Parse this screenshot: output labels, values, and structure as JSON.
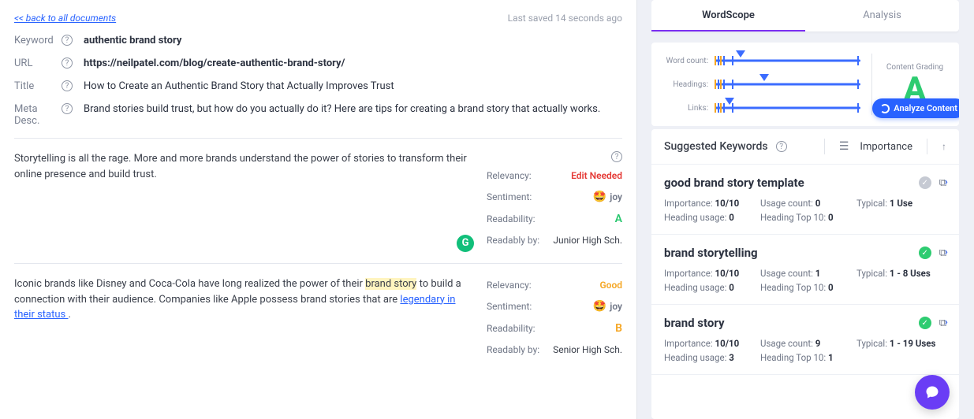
{
  "header": {
    "back_label": "<< back to all documents",
    "saved_label": "Last saved 14 seconds ago"
  },
  "meta": {
    "keyword_label": "Keyword",
    "keyword_value": "authentic brand story",
    "url_label": "URL",
    "url_value": "https://neilpatel.com/blog/create-authentic-brand-story/",
    "title_label": "Title",
    "title_value": "How to Create an Authentic Brand Story that Actually Improves Trust",
    "metadesc_label1": "Meta",
    "metadesc_label2": "Desc.",
    "metadesc_value": "Brand stories build trust, but how do you actually do it? Here are tips for creating a brand story that actually works."
  },
  "blocks": [
    {
      "text_pre": "Storytelling is all the rage. More and more brands understand the power of stories to transform their online presence and build trust.",
      "relevancy_label": "Relevancy:",
      "relevancy_value": "Edit Needed",
      "sentiment_label": "Sentiment:",
      "sentiment_value": "joy",
      "readability_label": "Readability:",
      "readability_value": "A",
      "readably_label": "Readably by:",
      "readably_value": "Junior High Sch."
    },
    {
      "text_parts": {
        "p1": "Iconic brands like Disney and Coca-Cola have long realized the power of their ",
        "hl": "brand story",
        "p2": " to build a connection with their audience. Companies like Apple possess brand stories that are ",
        "link": "legendary in their status ",
        "p3": "."
      },
      "relevancy_label": "Relevancy:",
      "relevancy_value": "Good",
      "sentiment_label": "Sentiment:",
      "sentiment_value": "joy",
      "readability_label": "Readability:",
      "readability_value": "B",
      "readably_label": "Readably by:",
      "readably_value": "Senior High Sch."
    }
  ],
  "right": {
    "tabs": {
      "wordscope": "WordScope",
      "analysis": "Analysis"
    },
    "metrics": {
      "wordcount_label": "Word count:",
      "headings_label": "Headings:",
      "links_label": "Links:",
      "grade_label": "Content Grading",
      "grade": "A",
      "analyze_label": "Analyze Content"
    },
    "suggested": {
      "title": "Suggested Keywords",
      "sort_label": "Importance",
      "items": [
        {
          "name": "good brand story template",
          "check": "grey",
          "importance_label": "Importance:",
          "importance": "10/10",
          "usage_label": "Usage count:",
          "usage": "0",
          "typical_label": "Typical:",
          "typical": "1 Use",
          "hu_label": "Heading usage:",
          "hu": "0",
          "ht_label": "Heading Top 10:",
          "ht": "0"
        },
        {
          "name": "brand storytelling",
          "check": "green",
          "importance_label": "Importance:",
          "importance": "10/10",
          "usage_label": "Usage count:",
          "usage": "1",
          "typical_label": "Typical:",
          "typical": "1 - 8 Uses",
          "hu_label": "Heading usage:",
          "hu": "0",
          "ht_label": "Heading Top 10:",
          "ht": "0"
        },
        {
          "name": "brand story",
          "check": "green",
          "importance_label": "Importance:",
          "importance": "10/10",
          "usage_label": "Usage count:",
          "usage": "9",
          "typical_label": "Typical:",
          "typical": "1 - 19 Uses",
          "hu_label": "Heading usage:",
          "hu": "3",
          "ht_label": "Heading Top 10:",
          "ht": "1"
        }
      ]
    }
  },
  "chart_data": {
    "type": "bar",
    "note": "Range meters with marker positions (0-100 of track).",
    "series": [
      {
        "name": "Word count",
        "ticks_blue": [
          2,
          6,
          12,
          98
        ],
        "ticks_orange": [
          0,
          4
        ],
        "marker": 18
      },
      {
        "name": "Headings",
        "ticks_blue": [
          2,
          6,
          12,
          98
        ],
        "ticks_orange": [
          0,
          4
        ],
        "marker": 34
      },
      {
        "name": "Links",
        "ticks_blue": [
          2,
          6,
          12,
          98
        ],
        "ticks_orange": [
          0,
          4
        ],
        "marker": 10
      }
    ]
  }
}
